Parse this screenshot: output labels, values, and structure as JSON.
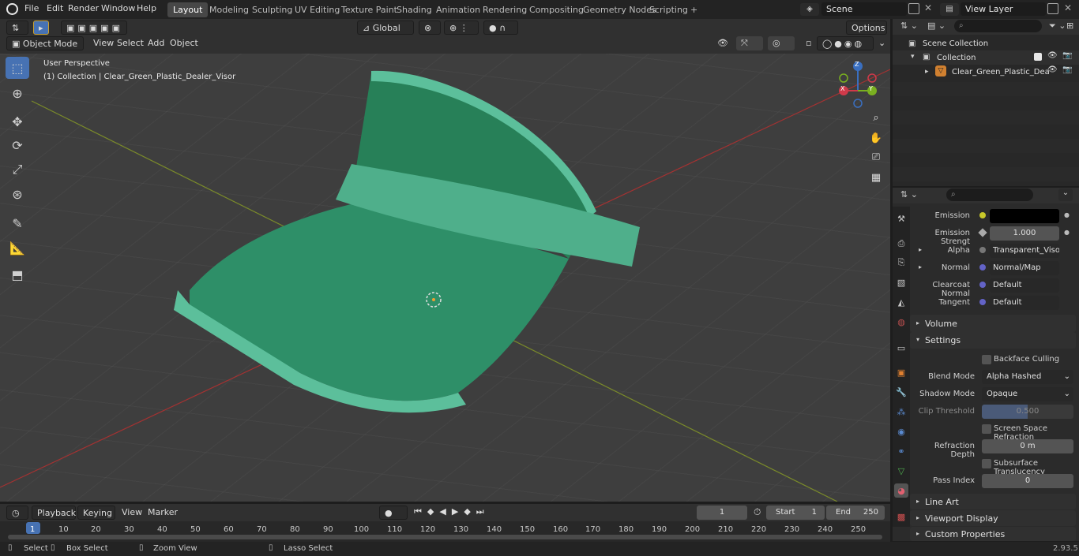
{
  "menu": [
    "File",
    "Edit",
    "Render",
    "Window",
    "Help"
  ],
  "workspaces": [
    "Layout",
    "Modeling",
    "Sculpting",
    "UV Editing",
    "Texture Paint",
    "Shading",
    "Animation",
    "Rendering",
    "Compositing",
    "Geometry Nodes",
    "Scripting"
  ],
  "active_workspace": "Layout",
  "scene_name": "Scene",
  "view_layer": "View Layer",
  "viewport": {
    "mode": "Object Mode",
    "menus": [
      "View",
      "Select",
      "Add",
      "Object"
    ],
    "transform": "Global",
    "options": "Options",
    "overlay_title": "User Perspective",
    "overlay_sub": "(1) Collection | Clear_Green_Plastic_Dealer_Visor",
    "gizmo": {
      "x": "X",
      "y": "Y",
      "z": "Z"
    }
  },
  "outliner": {
    "scene_collection": "Scene Collection",
    "collection": "Collection",
    "object": "Clear_Green_Plastic_Dea"
  },
  "properties": {
    "emission_label": "Emission",
    "emission_strength_label": "Emission Strengt",
    "emission_strength": "1.000",
    "alpha_label": "Alpha",
    "alpha_value": "Transparent_Visor_...",
    "normal_label": "Normal",
    "normal_value": "Normal/Map",
    "clearcoat_label": "Clearcoat Normal",
    "clearcoat_value": "Default",
    "tangent_label": "Tangent",
    "tangent_value": "Default",
    "volume": "Volume",
    "settings": "Settings",
    "backface": "Backface Culling",
    "blend_label": "Blend Mode",
    "blend_value": "Alpha Hashed",
    "shadow_label": "Shadow Mode",
    "shadow_value": "Opaque",
    "clip_label": "Clip Threshold",
    "clip_value": "0.500",
    "clip_fraction": 0.5,
    "ssr": "Screen Space Refraction",
    "refraction_label": "Refraction Depth",
    "refraction_value": "0 m",
    "subsurface": "Subsurface Translucency",
    "pass_label": "Pass Index",
    "pass_value": "0",
    "line_art": "Line Art",
    "viewport_display": "Viewport Display",
    "custom_props": "Custom Properties"
  },
  "timeline": {
    "menus": [
      "Playback",
      "Keying",
      "View",
      "Marker"
    ],
    "current_frame": "1",
    "start_label": "Start",
    "start": "1",
    "end_label": "End",
    "end": "250",
    "ticks": [
      "1",
      "10",
      "20",
      "30",
      "40",
      "50",
      "60",
      "70",
      "80",
      "90",
      "100",
      "110",
      "120",
      "130",
      "140",
      "150",
      "160",
      "170",
      "180",
      "190",
      "200",
      "210",
      "220",
      "230",
      "240",
      "250"
    ]
  },
  "statusbar": {
    "select": "Select",
    "box_select": "Box Select",
    "zoom_view": "Zoom View",
    "lasso_select": "Lasso Select",
    "version": "2.93.5"
  },
  "colors": {
    "accent": "#4772b3",
    "visor": "#2e8f68",
    "visor_edge": "#5cbf9b"
  }
}
